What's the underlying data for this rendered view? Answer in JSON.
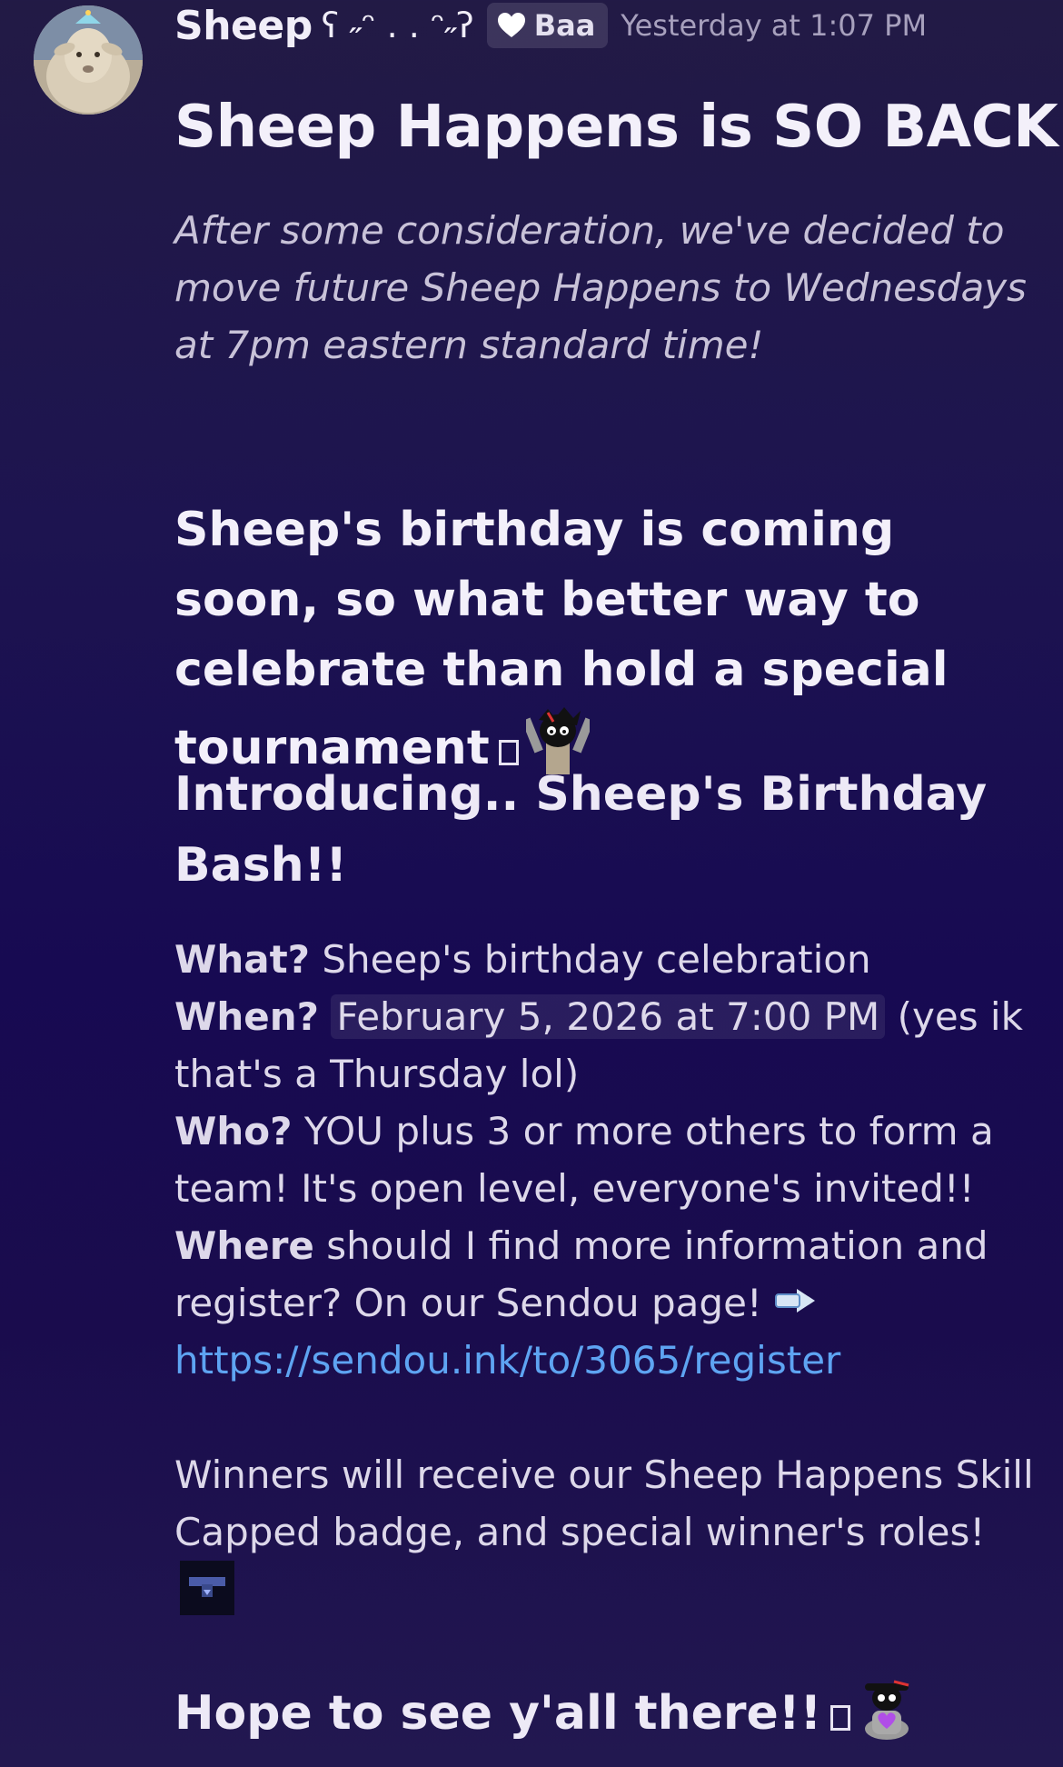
{
  "author": {
    "name": "Sheep",
    "name_decoration": "ʕ ˶ᵔ . . ᵔ˶ʔ",
    "tag_label": "Baa",
    "timestamp": "Yesterday at 1:07 PM"
  },
  "post": {
    "title": "Sheep Happens is SO BACK!!",
    "subtitle": "After some consideration, we've decided to move future Sheep Happens to Wednesdays at 7pm eastern standard time!",
    "birthday_line": "Sheep's birthday is coming soon, so what better way to celebrate than hold a special tournament",
    "intro_heading": "Introducing.. Sheep's Birthday Bash!!",
    "what_label": "What?",
    "what_text": "Sheep's birthday celebration",
    "when_label": "When?",
    "when_date": "February 5, 2026 at 7:00 PM",
    "when_note": "(yes ik that's a Thursday lol)",
    "who_label": "Who?",
    "who_text": "YOU plus 3 or more others to form a team! It's open level, everyone's invited!!",
    "where_label": "Where",
    "where_text": "should I find more information and register? On our Sendou page!",
    "register_link": "https://sendou.ink/to/3065/register",
    "winners_text": "Winners will receive our Sheep Happens Skill Capped badge, and special winner's roles!",
    "closing": "Hope to see y'all there!!"
  },
  "icons": {
    "avatar": "sheep-avatar",
    "tag_icon": "heart-icon",
    "arrow": "right-arrow-icon",
    "emoji_1": "cheering-character-emoji",
    "emoji_2": "badge-emoji",
    "emoji_3": "heart-holding-character-emoji"
  },
  "colors": {
    "link": "#5ea4f2",
    "heading": "#f3f0fa",
    "timestamp": "#a7a0bd"
  }
}
